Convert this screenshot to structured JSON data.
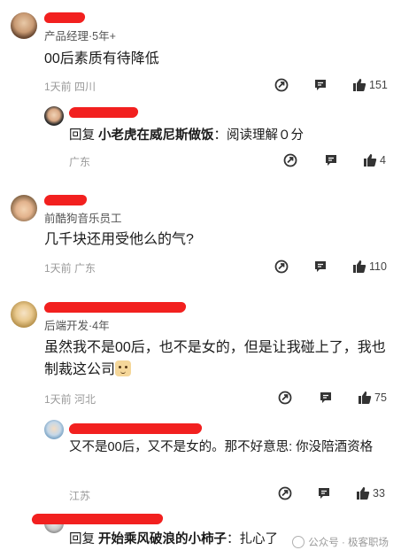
{
  "colors": {
    "redaction": "#f2201f",
    "meta": "#9a9a9a",
    "text": "#1a1a1a"
  },
  "comments": [
    {
      "role": "产品经理·5年+",
      "text": "00后素质有待降低",
      "meta": "1天前 四川",
      "likes": "151",
      "reply": {
        "prefix": "回复 ",
        "reply_to": "小老虎在威尼斯做饭",
        "text": "：阅读理解０分",
        "meta": "广东",
        "likes": "4"
      }
    },
    {
      "role": "前酷狗音乐员工",
      "text": "几千块还用受他么的气?",
      "meta": "1天前 广东",
      "likes": "110"
    },
    {
      "role": "后端开发·4年",
      "text": "虽然我不是00后，也不是女的，但是让我碰上了，我也制裁这公司",
      "emoji": "doge-emoji",
      "meta": "1天前 河北",
      "likes": "75",
      "reply": {
        "text": "又不是00后，又不是女的。那不好意思: 你没陪酒资格",
        "meta": "江苏",
        "likes": "33"
      }
    },
    {
      "reply": {
        "prefix": "回复 ",
        "reply_to": "开始乘风破浪的小柿子",
        "text": "：扎心了"
      }
    }
  ],
  "watermark": "公众号 · 极客职场",
  "icons": {
    "share": "share-icon",
    "comment": "comment-icon",
    "like": "thumbs-up-icon"
  }
}
